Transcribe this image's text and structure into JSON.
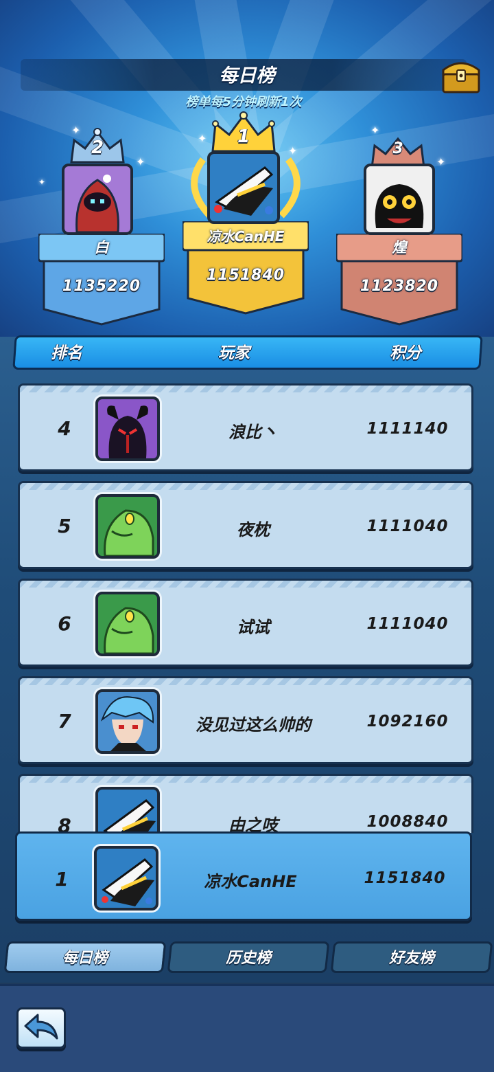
{
  "header": {
    "title": "每日榜",
    "subtitle": "榜单每5分钟刷新1次",
    "chest_icon": "treasure-chest-icon"
  },
  "podium": {
    "first": {
      "rank": "1",
      "name": "凉水CanHE",
      "score": "1151840"
    },
    "second": {
      "rank": "2",
      "name": "白",
      "score": "1135220"
    },
    "third": {
      "rank": "3",
      "name": "煌",
      "score": "1123820"
    }
  },
  "list_header": {
    "rank": "排名",
    "player": "玩家",
    "score": "积分"
  },
  "rows": [
    {
      "rank": "4",
      "name": "浪比丶",
      "score": "1111140"
    },
    {
      "rank": "5",
      "name": "夜枕",
      "score": "1111040"
    },
    {
      "rank": "6",
      "name": "试试",
      "score": "1111040"
    },
    {
      "rank": "7",
      "name": "没见过这么帅的",
      "score": "1092160"
    },
    {
      "rank": "8",
      "name": "由之吱",
      "score": "1008840"
    }
  ],
  "my_rank": {
    "rank": "1",
    "name": "凉水CanHE",
    "score": "1151840"
  },
  "tabs": [
    {
      "label": "每日榜",
      "active": true
    },
    {
      "label": "历史榜",
      "active": false
    },
    {
      "label": "好友榜",
      "active": false
    }
  ],
  "colors": {
    "gold": "#f5c83a",
    "silver": "#6fb6ec",
    "bronze": "#d98a78",
    "row_bg": "#c4dcef",
    "my_row_bg": "#5fb4ee"
  }
}
